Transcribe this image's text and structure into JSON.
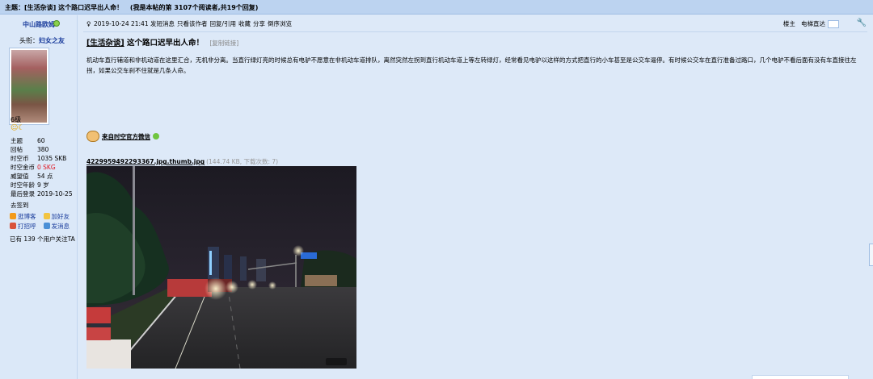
{
  "header": {
    "subject_label": "主题：",
    "thread_title": "[生活杂谈] 这个路口迟早出人命！",
    "thread_stats": "(我是本帖的第 3107个阅读者,共19个回复)"
  },
  "user": {
    "name": "中山路欧姆",
    "title_prefix": "头衔：",
    "title": "妇女之友",
    "level": "6级",
    "stats": [
      {
        "label": "主题",
        "value": "60"
      },
      {
        "label": "回帖",
        "value": "380"
      },
      {
        "label": "时空币",
        "value": "1035 SKB"
      },
      {
        "label": "时空金币",
        "value": "0 SKG"
      },
      {
        "label": "威望值",
        "value": "54 点"
      },
      {
        "label": "时空年龄",
        "value": "9 岁"
      },
      {
        "label": "最后登录",
        "value": "2019-10-25"
      }
    ],
    "signature_label": "去签到",
    "actions": [
      "逛博客",
      "加好友",
      "打招呼",
      "发消息"
    ],
    "followers": "已有 139 个用户关注TA"
  },
  "post": {
    "datetime": "2019-10-24 21:41",
    "meta_links": [
      "发短消息",
      "只看该作者",
      "回复/引用",
      "收藏",
      "分享",
      "倒序浏览"
    ],
    "floor_label": "楼主",
    "jump_label": "电梯直达",
    "category": "[生活杂谈]",
    "title": "这个路口迟早出人命！",
    "copy_link": "[复制链接]",
    "body": "机动车直行辅道和非机动道在这里汇合，无机非分离。当直行绿灯亮的时候总有电驴不愿意在非机动车道排队，离然突然左拐到直行机动车道上等左转绿灯，经常看见电驴以这样的方式把直行的小车甚至是公交车逼停。有时候公交车在直行准备过路口，几个电驴不看后面有没有车直接往左拐，如果公交车刹不住就是几条人命。",
    "source": "来自时空官方微信",
    "attachment_name": "4229959492293367.jpg.thumb.jpg",
    "attachment_info": "(144.74 KB, 下载次数: 7)"
  },
  "colors": {
    "background": "#dde9f8",
    "header_bar": "#bcd3f0",
    "link_blue": "#1b3d9c",
    "red": "#e0141e"
  }
}
